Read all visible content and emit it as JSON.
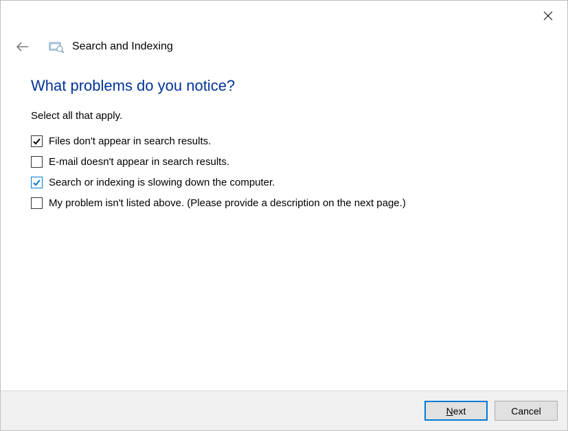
{
  "window": {
    "title": "Search and Indexing"
  },
  "main": {
    "heading": "What problems do you notice?",
    "subheading": "Select all that apply."
  },
  "options": [
    {
      "label": "Files don't appear in search results.",
      "checked": true,
      "check_color": "black"
    },
    {
      "label": "E-mail doesn't appear in search results.",
      "checked": false,
      "check_color": "none"
    },
    {
      "label": "Search or indexing is slowing down the computer.",
      "checked": true,
      "check_color": "blue"
    },
    {
      "label": "My problem isn't listed above. (Please provide a description on the next page.)",
      "checked": false,
      "check_color": "none"
    }
  ],
  "footer": {
    "next_prefix": "N",
    "next_suffix": "ext",
    "cancel_label": "Cancel"
  },
  "icons": {
    "close": "close-icon",
    "back": "back-arrow-icon",
    "troubleshooter": "troubleshooter-icon"
  }
}
